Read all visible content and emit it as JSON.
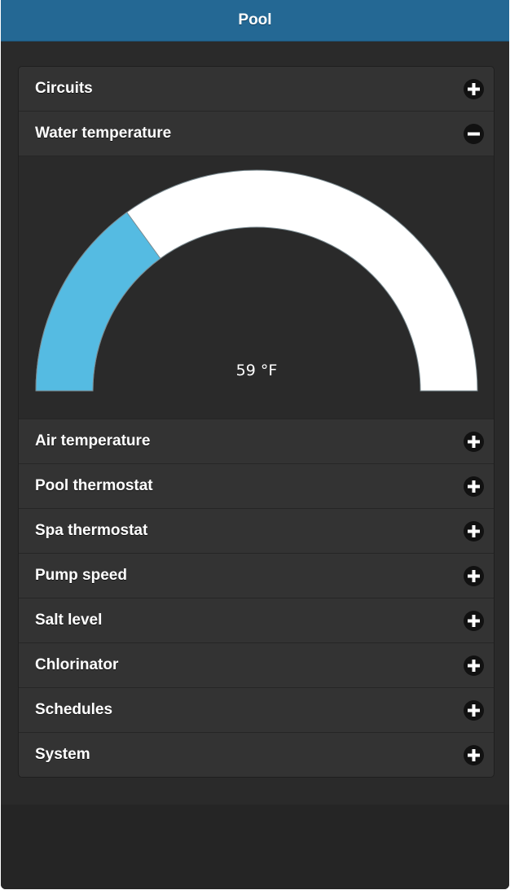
{
  "header": {
    "title": "Pool"
  },
  "accordion": {
    "sections": [
      {
        "label": "Circuits",
        "state": "collapsed"
      },
      {
        "label": "Water temperature",
        "state": "expanded"
      },
      {
        "label": "Air temperature",
        "state": "collapsed"
      },
      {
        "label": "Pool thermostat",
        "state": "collapsed"
      },
      {
        "label": "Spa thermostat",
        "state": "collapsed"
      },
      {
        "label": "Pump speed",
        "state": "collapsed"
      },
      {
        "label": "Salt level",
        "state": "collapsed"
      },
      {
        "label": "Chlorinator",
        "state": "collapsed"
      },
      {
        "label": "Schedules",
        "state": "collapsed"
      },
      {
        "label": "System",
        "state": "collapsed"
      }
    ]
  },
  "gauge": {
    "value_text": "59 °F",
    "fill_fraction": 0.3,
    "fill_color": "#55bbe2",
    "track_color": "#ffffff"
  },
  "colors": {
    "header_bg": "#246894",
    "row_bg": "#333333",
    "page_bg": "#2a2a2a"
  }
}
